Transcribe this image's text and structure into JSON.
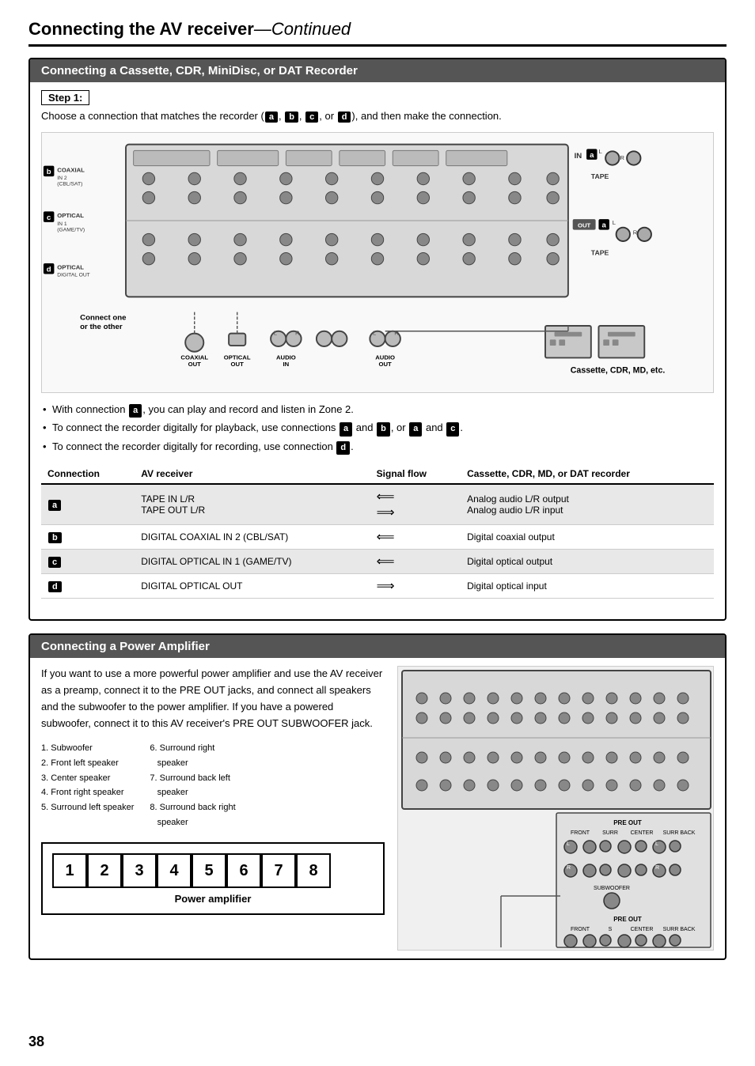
{
  "page": {
    "number": "38",
    "main_title": "Connecting the AV receiver",
    "main_title_continued": "—Continued"
  },
  "section1": {
    "header": "Connecting a Cassette, CDR, MiniDisc, or DAT Recorder",
    "step_label": "Step 1:",
    "step_desc_pre": "Choose a connection that matches the recorder (",
    "step_desc_badges": [
      "a",
      "b",
      "c",
      "d"
    ],
    "step_desc_post": "), and then make the connection.",
    "diagram_labels": {
      "b": "b",
      "c": "c",
      "d": "d",
      "a_right_top": "a",
      "a_right_bot": "a",
      "coaxial": "COAXIAL\nIN 2\n(CBL/SAT)",
      "optical": "OPTICAL\nIN 1\n(GAME/TV)",
      "optical_digital": "OPTICAL\nDIGITAL OUT",
      "tape_in": "IN",
      "tape_out": "OUT",
      "tape_label": "TAPE",
      "connect_one": "Connect one\nor the other",
      "cassette_label": "Cassette, CDR, MD, etc."
    },
    "bottom_jacks": [
      {
        "label": "COAXIAL\nOUT"
      },
      {
        "label": "OPTICAL\nOUT"
      },
      {
        "label": "AUDIO\nIN"
      },
      {
        "label": "AUDIO\nOUT"
      }
    ],
    "bullets": [
      "With connection a, you can play and record and listen in Zone 2.",
      "To connect the recorder digitally for playback, use connections a and b, or a and c.",
      "To connect the recorder digitally for recording, use connection d."
    ],
    "table": {
      "headers": [
        "Connection",
        "AV receiver",
        "Signal flow",
        "Cassette, CDR, MD, or DAT recorder"
      ],
      "rows": [
        {
          "badge": "a",
          "shaded": true,
          "av": "TAPE IN L/R\nTAPE OUT L/R",
          "flow": [
            "⟸",
            "⟹"
          ],
          "recorder": "Analog audio L/R output\nAnalog audio L/R input"
        },
        {
          "badge": "b",
          "shaded": false,
          "av": "DIGITAL COAXIAL IN 2 (CBL/SAT)",
          "flow": [
            "⟸"
          ],
          "recorder": "Digital coaxial output"
        },
        {
          "badge": "c",
          "shaded": true,
          "av": "DIGITAL OPTICAL IN 1 (GAME/TV)",
          "flow": [
            "⟸"
          ],
          "recorder": "Digital optical output"
        },
        {
          "badge": "d",
          "shaded": false,
          "av": "DIGITAL OPTICAL OUT",
          "flow": [
            "⟹"
          ],
          "recorder": "Digital optical input"
        }
      ]
    }
  },
  "section2": {
    "header": "Connecting a Power Amplifier",
    "body_text": "If you want to use a more powerful power amplifier and use the AV receiver as a preamp, connect it to the PRE OUT jacks, and connect all speakers and the subwoofer to the power amplifier. If you have a powered subwoofer, connect it to this AV receiver's PRE OUT SUBWOOFER jack.",
    "speaker_list_left": [
      "1. Subwoofer",
      "2. Front left speaker",
      "3. Center speaker",
      "4. Front right speaker",
      "5. Surround left speaker"
    ],
    "speaker_list_right": [
      "6. Surround right",
      "    speaker",
      "7. Surround back left",
      "    speaker",
      "8. Surround back right",
      "    speaker"
    ],
    "amp_numbers": [
      "1",
      "2",
      "3",
      "4",
      "5",
      "6",
      "7",
      "8"
    ],
    "amp_label": "Power amplifier",
    "pre_out_labels": [
      "FRONT",
      "SURR",
      "CENTER",
      "SURR BACK"
    ]
  }
}
